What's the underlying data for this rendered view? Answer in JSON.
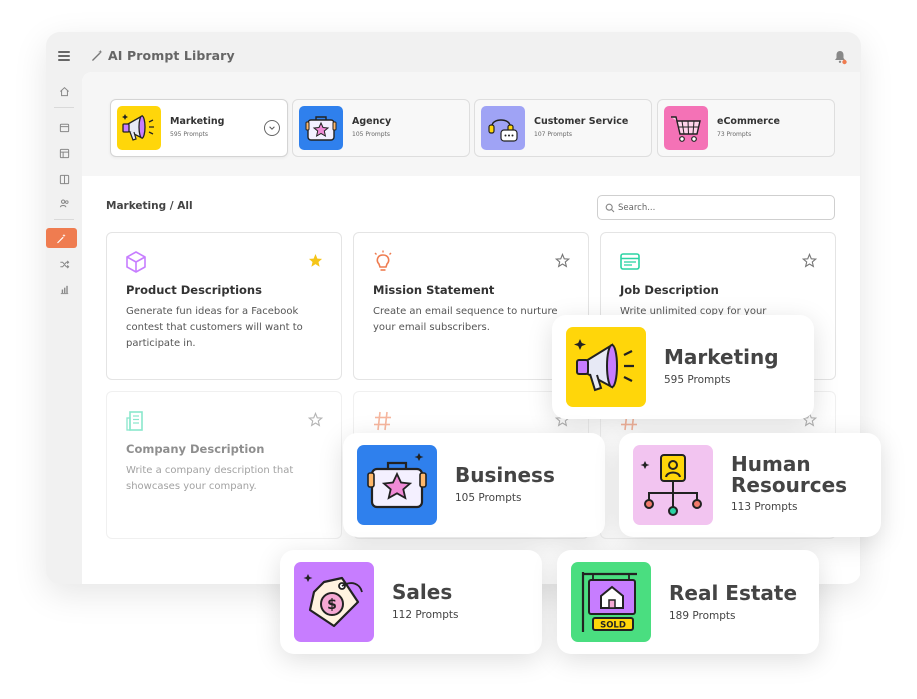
{
  "app": {
    "title": "AI Prompt Library"
  },
  "categories": [
    {
      "name": "Marketing",
      "count": "595 Prompts",
      "icon": "megaphone-icon",
      "color": "#ffd60a",
      "selected": true
    },
    {
      "name": "Agency",
      "count": "105 Prompts",
      "icon": "briefcase-icon",
      "color": "#2f80ed"
    },
    {
      "name": "Customer Service",
      "count": "107 Prompts",
      "icon": "headset-chat-icon",
      "color": "#9fa3f5"
    },
    {
      "name": "eCommerce",
      "count": "73 Prompts",
      "icon": "shopping-cart-icon",
      "color": "#f472b6"
    }
  ],
  "breadcrumb": "Marketing / All",
  "search": {
    "placeholder": "Search..."
  },
  "prompts": [
    {
      "title": "Product Descriptions",
      "desc": "Generate fun ideas for a Facebook contest that customers will want to participate in.",
      "icon": "cube-icon",
      "favorite": true
    },
    {
      "title": "Mission Statement",
      "desc": "Create an email sequence to nurture your email subscribers.",
      "icon": "lightbulb-icon",
      "favorite": false
    },
    {
      "title": "Job Description",
      "desc": "Write unlimited copy for your",
      "icon": "browser-window-icon",
      "favorite": false
    },
    {
      "title": "Company Description",
      "desc": "Write a company description that showcases your company.",
      "icon": "building-icon",
      "favorite": false
    },
    {
      "title": "",
      "desc": "",
      "icon": "hashtag-icon",
      "favorite": false
    },
    {
      "title": "",
      "desc": "",
      "icon": "hashtag-icon",
      "favorite": false
    }
  ],
  "feature_cards": [
    {
      "name": "Marketing",
      "count": "595 Prompts",
      "icon": "megaphone-icon",
      "color": "#ffd60a"
    },
    {
      "name": "Business",
      "count": "105 Prompts",
      "icon": "briefcase-icon",
      "color": "#2f80ed"
    },
    {
      "name_line1": "Human",
      "name_line2": "Resources",
      "count": "113 Prompts",
      "icon": "org-chart-icon",
      "color": "#f2c4f0"
    },
    {
      "name": "Sales",
      "count": "112 Prompts",
      "icon": "price-tag-icon",
      "color": "#c77dff"
    },
    {
      "name": "Real Estate",
      "count": "189 Prompts",
      "icon": "sold-sign-icon",
      "color": "#4ade80",
      "badge": "SOLD"
    }
  ],
  "colors": {
    "accent": "#ef7c50",
    "star": "#f5c518"
  }
}
